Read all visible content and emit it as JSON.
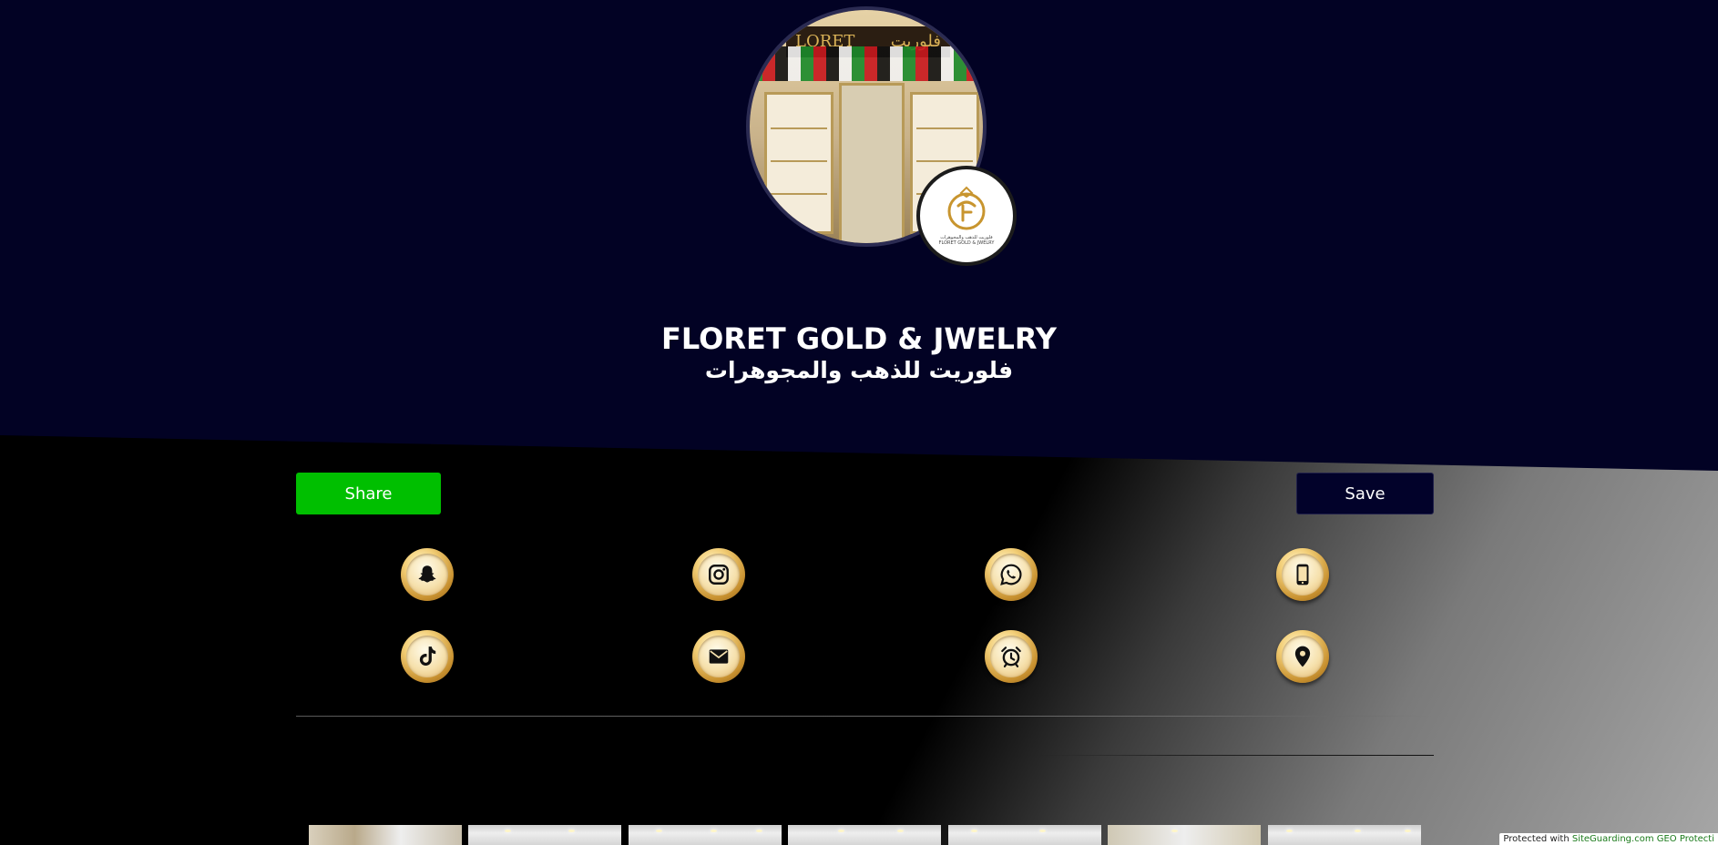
{
  "profile": {
    "name_en": "FLORET GOLD & JWELRY",
    "name_ar": "فلوريت للذهب والمجوهرات",
    "cover_sign_en": "LORET",
    "cover_sign_ar": "فلوريت",
    "logo_caption_ar": "فلوريت للذهب والمجوهرات",
    "logo_caption_en": "FLORET GOLD & JWELRY"
  },
  "actions": {
    "share_label": "Share",
    "save_label": "Save"
  },
  "contact_icons": [
    {
      "name": "snapchat-icon"
    },
    {
      "name": "instagram-icon"
    },
    {
      "name": "whatsapp-icon"
    },
    {
      "name": "mobile-phone-icon"
    },
    {
      "name": "tiktok-icon"
    },
    {
      "name": "email-icon"
    },
    {
      "name": "alarm-clock-icon"
    },
    {
      "name": "location-pin-icon"
    }
  ],
  "gallery": {
    "visible_thumbnails": 7
  },
  "footer": {
    "protected_prefix": "Protected with ",
    "protected_link": "SiteGuarding.com GEO Protecti"
  },
  "colors": {
    "header_bg": "#020224",
    "share_button": "#00bf00",
    "save_button": "#02022a",
    "gold": "#d9a844"
  }
}
